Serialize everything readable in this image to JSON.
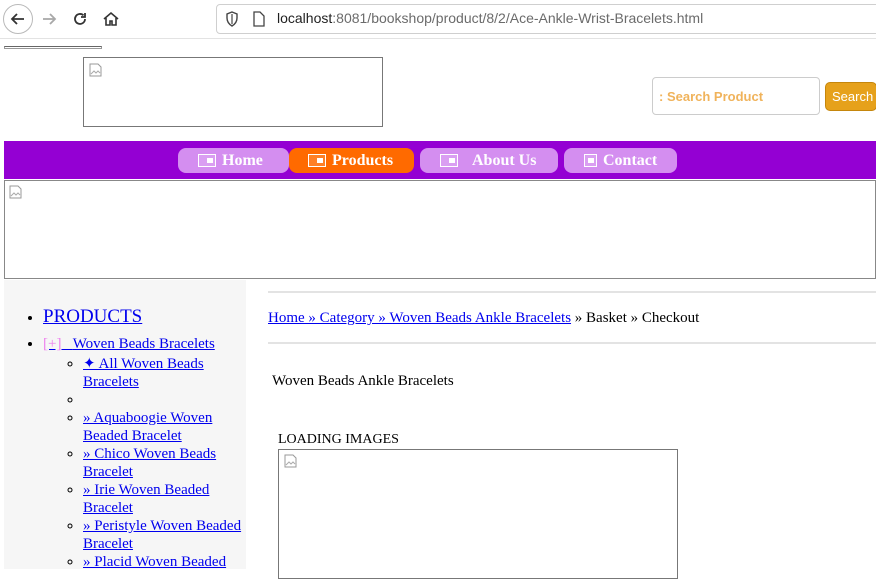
{
  "browser": {
    "url_host": "localhost",
    "url_rest": ":8081/bookshop/product/8/2/Ace-Ankle-Wrist-Bracelets.html"
  },
  "search": {
    "placeholder": ": Search Product",
    "button_label": "Search"
  },
  "nav": {
    "items": [
      {
        "label": "Home"
      },
      {
        "label": "Products"
      },
      {
        "label": "About Us"
      },
      {
        "label": "Contact"
      }
    ],
    "colors": {
      "band": "#9400d3",
      "item": "#d48ef0",
      "active": "#ff6a00"
    }
  },
  "sidebar": {
    "products_label": "PRODUCTS",
    "category": {
      "toggle": "[+]",
      "label": "Woven Beads Bracelets"
    },
    "subitems": [
      "✦   All Woven Beads Bracelets",
      "",
      "» Aquaboogie Woven Beaded Bracelet",
      "» Chico Woven Beads Bracelet",
      "» Irie Woven Beaded Bracelet",
      "» Peristyle Woven Beaded Bracelet",
      "» Placid Woven Beaded"
    ]
  },
  "breadcrumb": {
    "link": "Home » Category » Woven Beads Ankle Bracelets",
    "rest": " » Basket » Checkout"
  },
  "main": {
    "category_title": "Woven Beads Ankle Bracelets",
    "loading_text": "LOADING IMAGES"
  }
}
